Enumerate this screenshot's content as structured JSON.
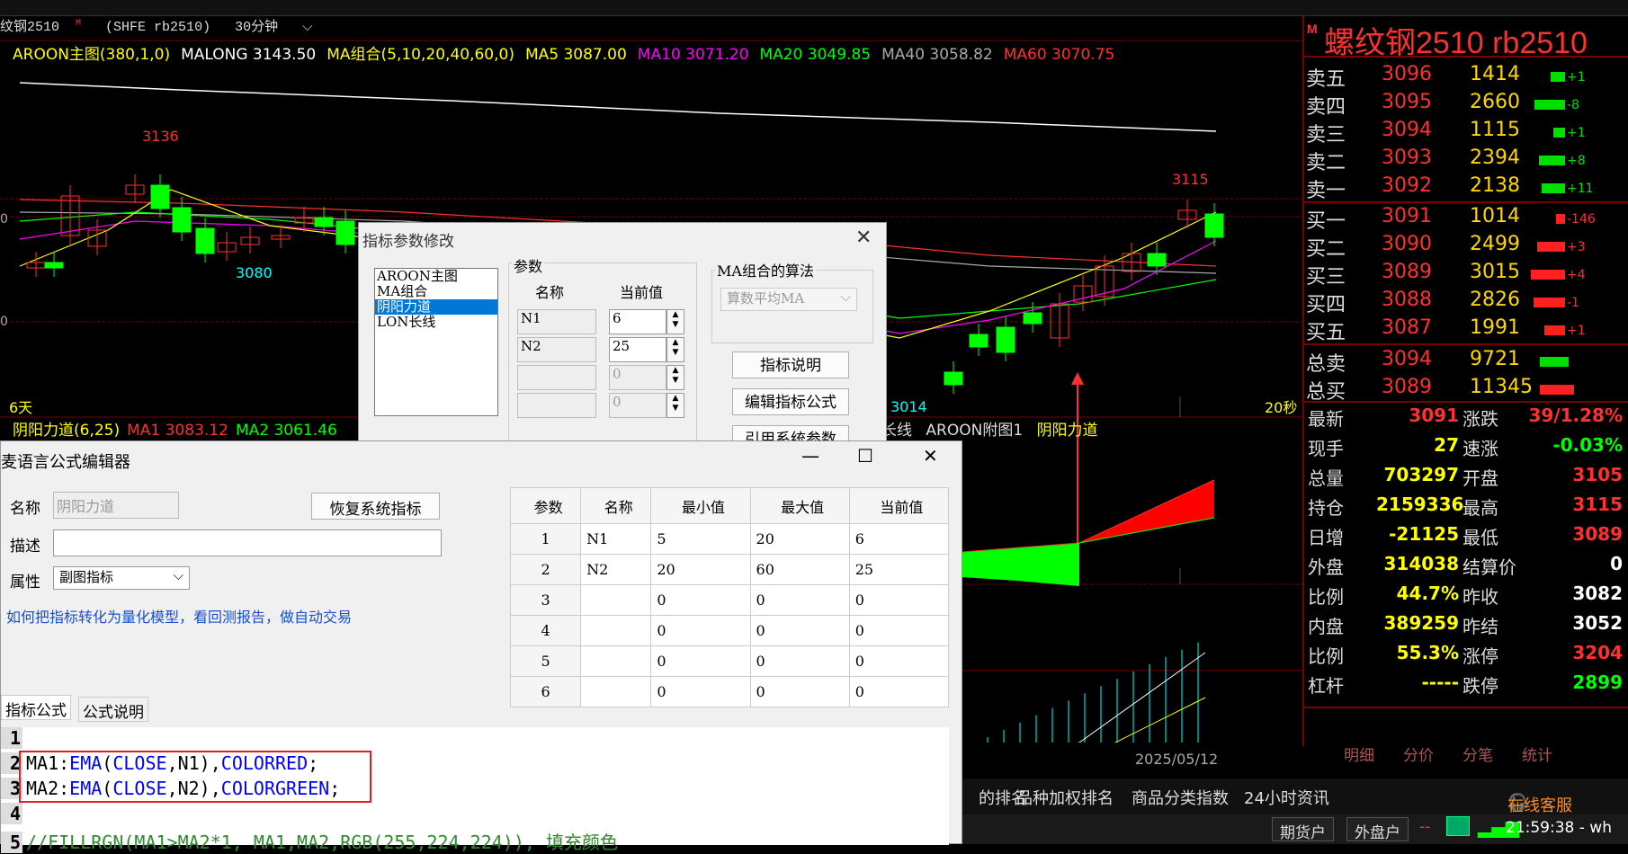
{
  "window": {
    "title_prefix": "纹钢2510",
    "title_mark": "M",
    "exchange": "(SHFE rb2510)",
    "period": "30分钟",
    "period_chevron": "chevron-down"
  },
  "indicator_header": [
    {
      "text": "AROON主图(380,1,0)",
      "color": "#ffff00"
    },
    {
      "text": "MALONG 3143.50",
      "color": "#ffffff"
    },
    {
      "text": "MA组合(5,10,20,40,60,0)",
      "color": "#ffff00"
    },
    {
      "text": "MA5 3087.00",
      "color": "#ffff00"
    },
    {
      "text": "MA10 3071.20",
      "color": "#ff00ff"
    },
    {
      "text": "MA20 3049.85",
      "color": "#00ff00"
    },
    {
      "text": "MA40 3058.82",
      "color": "#aaaaaa"
    },
    {
      "text": "MA60 3070.75",
      "color": "#ff3030"
    }
  ],
  "chart_labels": {
    "high_left": "3136",
    "low_left": "3080",
    "high_right": "3115",
    "low_right": "3014",
    "left_days": "6天",
    "right_secs": "20秒",
    "date": "2025/05/12",
    "axis_left_1": "0",
    "axis_left_2": "0"
  },
  "sub_header": [
    {
      "text": "阴阳力道(6,25)",
      "color": "#ffff00"
    },
    {
      "text": "MA1 3083.12",
      "color": "#ff3030"
    },
    {
      "text": "MA2 3061.46",
      "color": "#00ff00"
    }
  ],
  "sub_header2": {
    "part1": "长线",
    "part2": "AROON附图1",
    "part3": "阴阳力道"
  },
  "quote": {
    "title": "螺纹钢2510  rb2510",
    "mark": "M",
    "asks": [
      {
        "label": "卖五",
        "price": "3096",
        "vol": "1414",
        "chg": "+1",
        "bar": 0.35,
        "color": "green"
      },
      {
        "label": "卖四",
        "price": "3095",
        "vol": "2660",
        "chg": "-8",
        "bar": 0.75,
        "color": "green"
      },
      {
        "label": "卖三",
        "price": "3094",
        "vol": "1115",
        "chg": "+1",
        "bar": 0.28,
        "color": "green"
      },
      {
        "label": "卖二",
        "price": "3093",
        "vol": "2394",
        "chg": "+8",
        "bar": 0.65,
        "color": "green"
      },
      {
        "label": "卖一",
        "price": "3092",
        "vol": "2138",
        "chg": "+11",
        "bar": 0.58,
        "color": "green"
      }
    ],
    "bids": [
      {
        "label": "买一",
        "price": "3091",
        "vol": "1014",
        "chg": "-146",
        "bar": 0.22,
        "color": "red"
      },
      {
        "label": "买二",
        "price": "3090",
        "vol": "2499",
        "chg": "+3",
        "bar": 0.68,
        "color": "red"
      },
      {
        "label": "买三",
        "price": "3089",
        "vol": "3015",
        "chg": "+4",
        "bar": 0.85,
        "color": "red"
      },
      {
        "label": "买四",
        "price": "3088",
        "vol": "2826",
        "chg": "-1",
        "bar": 0.78,
        "color": "red"
      },
      {
        "label": "买五",
        "price": "3087",
        "vol": "1991",
        "chg": "+1",
        "bar": 0.52,
        "color": "red"
      }
    ],
    "totals": [
      {
        "label": "总卖",
        "price": "3094",
        "vol": "9721",
        "bar": 0.8,
        "color": "green"
      },
      {
        "label": "总买",
        "price": "3089",
        "vol": "11345",
        "bar": 0.95,
        "color": "red"
      }
    ],
    "stats": [
      {
        "l1": "最新",
        "v1": "3091",
        "c1": "#ff3030",
        "l2": "涨跌",
        "v2": "39/1.28%",
        "c2": "#ff3030"
      },
      {
        "l1": "现手",
        "v1": "27",
        "c1": "#ffff00",
        "l2": "速涨",
        "v2": "-0.03%",
        "c2": "#00ff00"
      },
      {
        "l1": "总量",
        "v1": "703297",
        "c1": "#ffff00",
        "l2": "开盘",
        "v2": "3105",
        "c2": "#ff3030"
      },
      {
        "l1": "持仓",
        "v1": "2159336",
        "c1": "#ffff00",
        "l2": "最高",
        "v2": "3115",
        "c2": "#ff3030"
      },
      {
        "l1": "日增",
        "v1": "-21125",
        "c1": "#ffff00",
        "l2": "最低",
        "v2": "3089",
        "c2": "#ff3030"
      },
      {
        "l1": "外盘",
        "v1": "314038",
        "c1": "#ffff00",
        "l2": "结算价",
        "v2": "0",
        "c2": "#ffffff"
      },
      {
        "l1": "比例",
        "v1": "44.7%",
        "c1": "#ffff00",
        "l2": "昨收",
        "v2": "3082",
        "c2": "#ffffff"
      },
      {
        "l1": "内盘",
        "v1": "389259",
        "c1": "#ffff00",
        "l2": "昨结",
        "v2": "3052",
        "c2": "#ffffff"
      },
      {
        "l1": "比例",
        "v1": "55.3%",
        "c1": "#ffff00",
        "l2": "涨停",
        "v2": "3204",
        "c2": "#ff3030"
      },
      {
        "l1": "杠杆",
        "v1": "-----",
        "c1": "#ffff00",
        "l2": "跌停",
        "v2": "2899",
        "c2": "#00ff00"
      }
    ],
    "tabs": [
      "明细",
      "分价",
      "分笔",
      "统计"
    ]
  },
  "bottom_links": [
    "的排名",
    "品种加权排名",
    "商品分类指数",
    "24小时资讯"
  ],
  "service": "在线客服",
  "status": {
    "btn1": "期货户",
    "btn2": "外盘户",
    "time": "21:59:38 - wh"
  },
  "param_dialog": {
    "title": "指标参数修改",
    "list": [
      "AROON主图",
      "MA组合",
      "阴阳力道",
      "LON长线"
    ],
    "selected": 2,
    "group_title": "参数",
    "col_name": "名称",
    "col_value": "当前值",
    "params": [
      {
        "name": "N1",
        "value": "6"
      },
      {
        "name": "N2",
        "value": "25"
      },
      {
        "name": "",
        "value": "0"
      },
      {
        "name": "",
        "value": "0"
      }
    ],
    "algo_title": "MA组合的算法",
    "algo_value": "算数平均MA",
    "btn_desc": "指标说明",
    "btn_edit": "编辑指标公式",
    "btn_ref": "引用系统参数"
  },
  "editor": {
    "title": "麦语言公式编辑器",
    "name_label": "名称",
    "name_value": "阴阳力道",
    "restore_btn": "恢复系统指标",
    "desc_label": "描述",
    "prop_label": "属性",
    "prop_value": "副图指标",
    "link": "如何把指标转化为量化模型，看回测报告，做自动交易",
    "table_headers": [
      "参数",
      "名称",
      "最小值",
      "最大值",
      "当前值"
    ],
    "table_rows": [
      [
        "1",
        "N1",
        "5",
        "20",
        "6"
      ],
      [
        "2",
        "N2",
        "20",
        "60",
        "25"
      ],
      [
        "3",
        "",
        "0",
        "0",
        "0"
      ],
      [
        "4",
        "",
        "0",
        "0",
        "0"
      ],
      [
        "5",
        "",
        "0",
        "0",
        "0"
      ],
      [
        "6",
        "",
        "0",
        "0",
        "0"
      ]
    ],
    "tab_formula": "指标公式",
    "tab_help": "公式说明",
    "line_numbers": [
      "1",
      "2",
      "3",
      "4",
      "5"
    ],
    "line2": {
      "a": "MA1:",
      "b": "EMA",
      "c": "(",
      "d": "CLOSE",
      "e": ",N1),",
      "f": "COLORRED",
      ";": ";"
    },
    "line3": {
      "a": "MA2:",
      "b": "EMA",
      "c": "(",
      "d": "CLOSE",
      "e": ",N2),",
      "f": "COLORGREEN",
      ";": ";"
    },
    "line5": "//FILLRGN(MA1>MA2*1, MA1,MA2,RGB(255,224,224)), 填充颜色"
  }
}
